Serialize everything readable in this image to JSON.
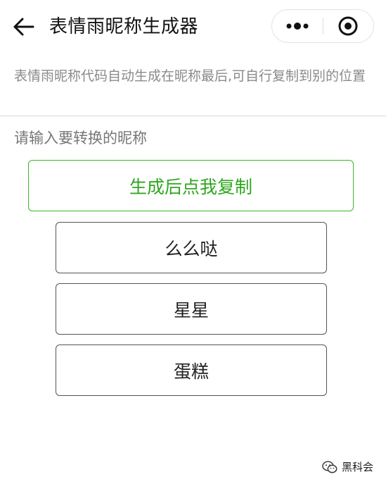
{
  "header": {
    "title": "表情雨昵称生成器",
    "back_icon": "arrow-left-icon",
    "menu_icon": "more-dots-icon",
    "close_icon": "target-circle-icon"
  },
  "notice": {
    "text": "表情雨昵称代码自动生成在昵称最后,可自行复制到别的位置"
  },
  "input": {
    "placeholder": "请输入要转换的昵称",
    "value": ""
  },
  "buttons": {
    "generate_label": "生成后点我复制",
    "options": [
      {
        "label": "么么哒"
      },
      {
        "label": "星星"
      },
      {
        "label": "蛋糕"
      }
    ]
  },
  "watermark": {
    "text": "黑科会",
    "icon": "wechat-icon"
  },
  "colors": {
    "accent_green": "#3cb52a",
    "notice_gray": "#8a8a8a",
    "border_dark": "#555555"
  }
}
